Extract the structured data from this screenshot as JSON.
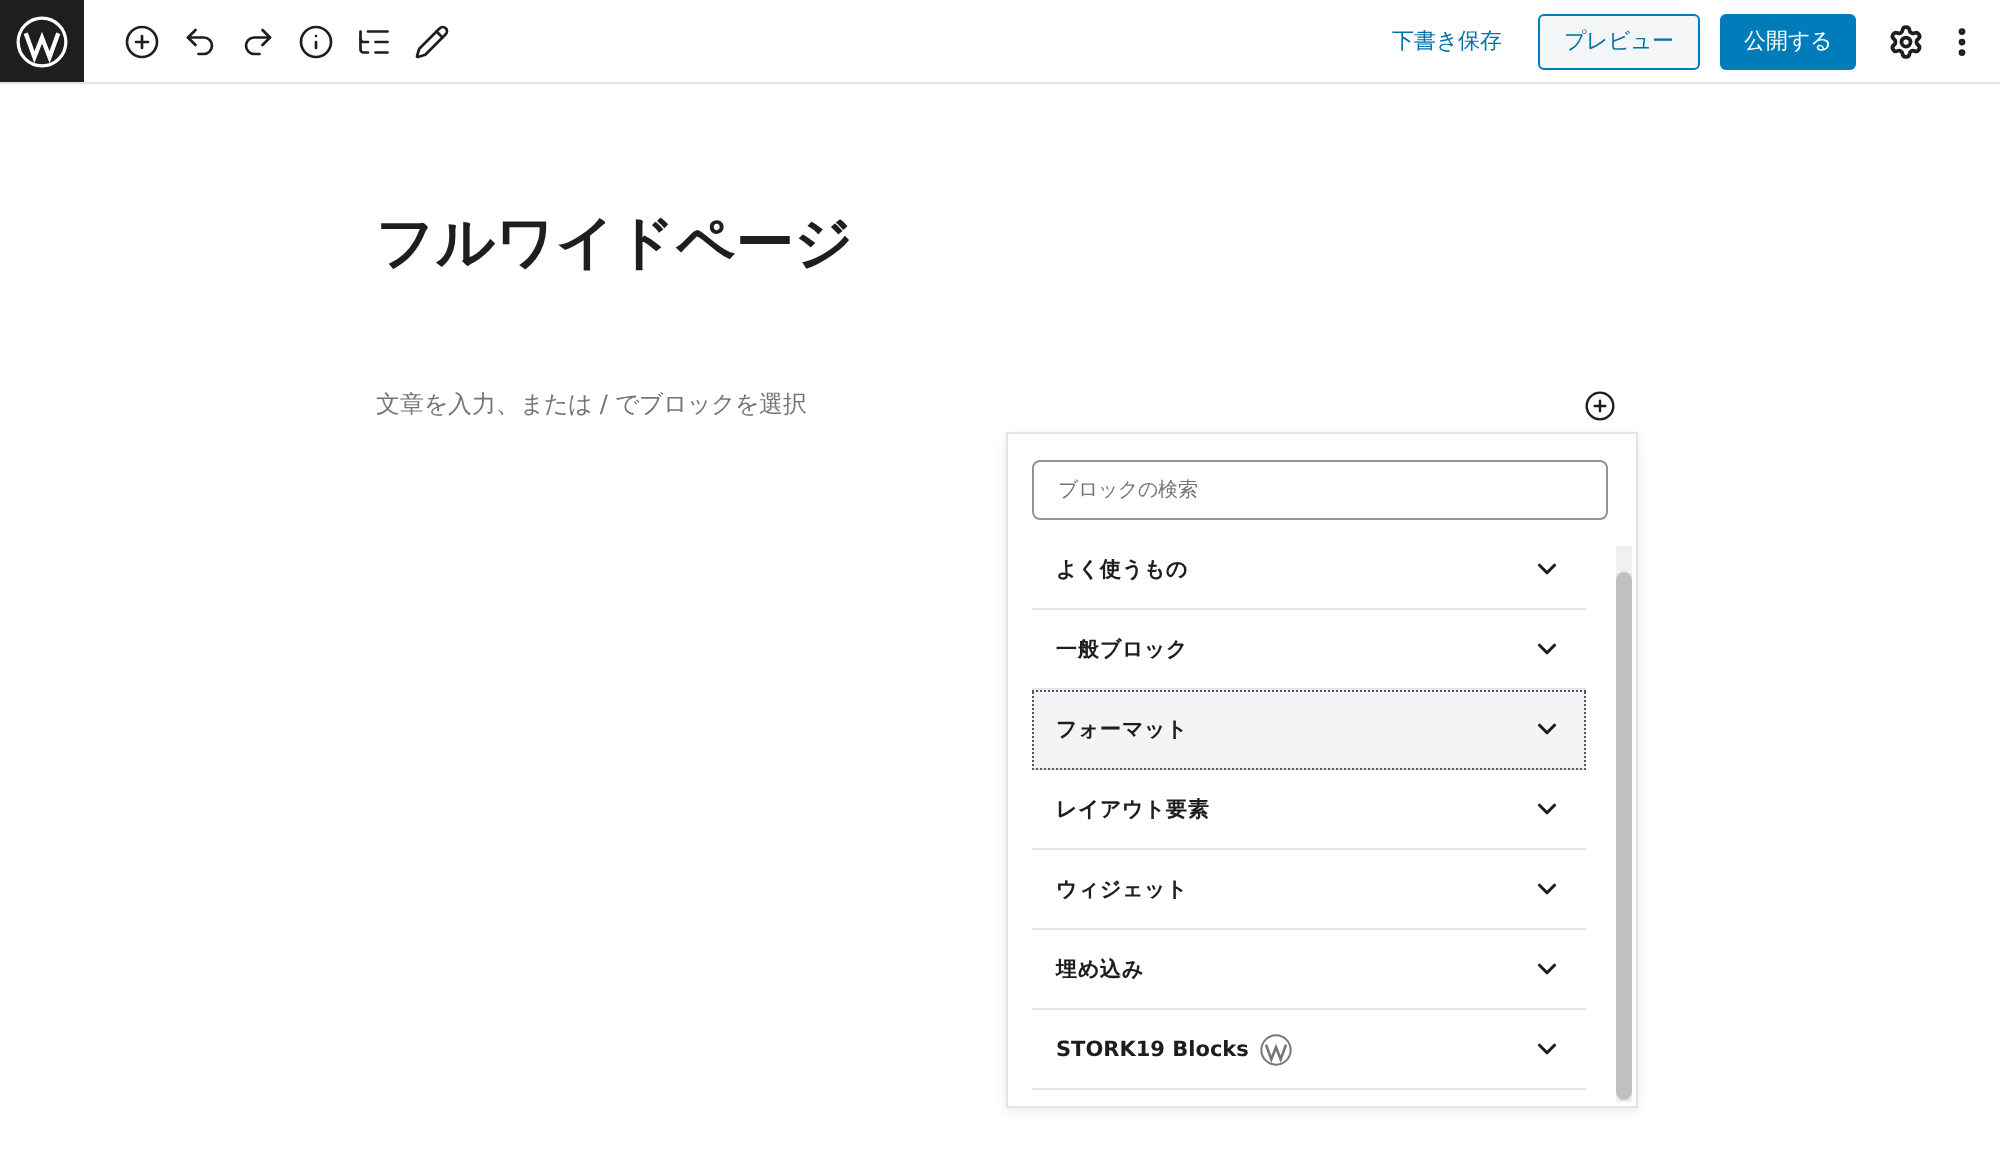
{
  "toolbar": {
    "save_draft": "下書き保存",
    "preview": "プレビュー",
    "publish": "公開する"
  },
  "editor": {
    "title": "フルワイドページ",
    "paragraph_placeholder": "文章を入力、または / でブロックを選択"
  },
  "inserter": {
    "search": {
      "placeholder": "ブロックの検索"
    },
    "categories": [
      {
        "label": "よく使うもの",
        "selected": false,
        "kind": "plain"
      },
      {
        "label": "一般ブロック",
        "selected": false,
        "kind": "plain"
      },
      {
        "label": "フォーマット",
        "selected": true,
        "kind": "plain"
      },
      {
        "label": "レイアウト要素",
        "selected": false,
        "kind": "plain"
      },
      {
        "label": "ウィジェット",
        "selected": false,
        "kind": "plain"
      },
      {
        "label": "埋め込み",
        "selected": false,
        "kind": "plain"
      },
      {
        "label": "STORK19 Blocks",
        "selected": false,
        "kind": "logo"
      }
    ]
  }
}
